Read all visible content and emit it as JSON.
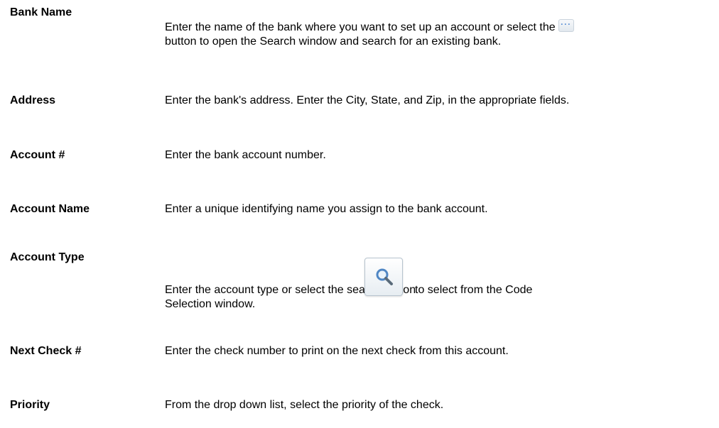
{
  "rows": [
    {
      "term": "Bank Name",
      "desc_before_icon": "Enter the name of the bank where you want to set up an account or select the",
      "desc_after_icon": "button to open the Search window and search for an existing bank.",
      "icon": "ellipsis-icon"
    },
    {
      "term": "Address",
      "desc": "Enter the bank's address. Enter the City, State, and Zip, in the appropriate fields."
    },
    {
      "term": "Account #",
      "desc": "Enter the bank account number."
    },
    {
      "term": "Account Name",
      "desc": "Enter a unique identifying name you assign to the bank account."
    },
    {
      "term": "Account Type",
      "desc_before_icon": "Enter the account type or select the search button",
      "desc_after_icon": "to select from  the Code",
      "desc_line2": "Selection window.",
      "icon": "search-icon"
    },
    {
      "term": "Next Check #",
      "desc": "Enter the check number to print on the next check from this account."
    },
    {
      "term": "Priority",
      "desc": "From the drop down list, select the priority of the check."
    }
  ],
  "colors": {
    "text": "#000000",
    "background": "#ffffff",
    "icon_accent": "#5a8fd6"
  }
}
